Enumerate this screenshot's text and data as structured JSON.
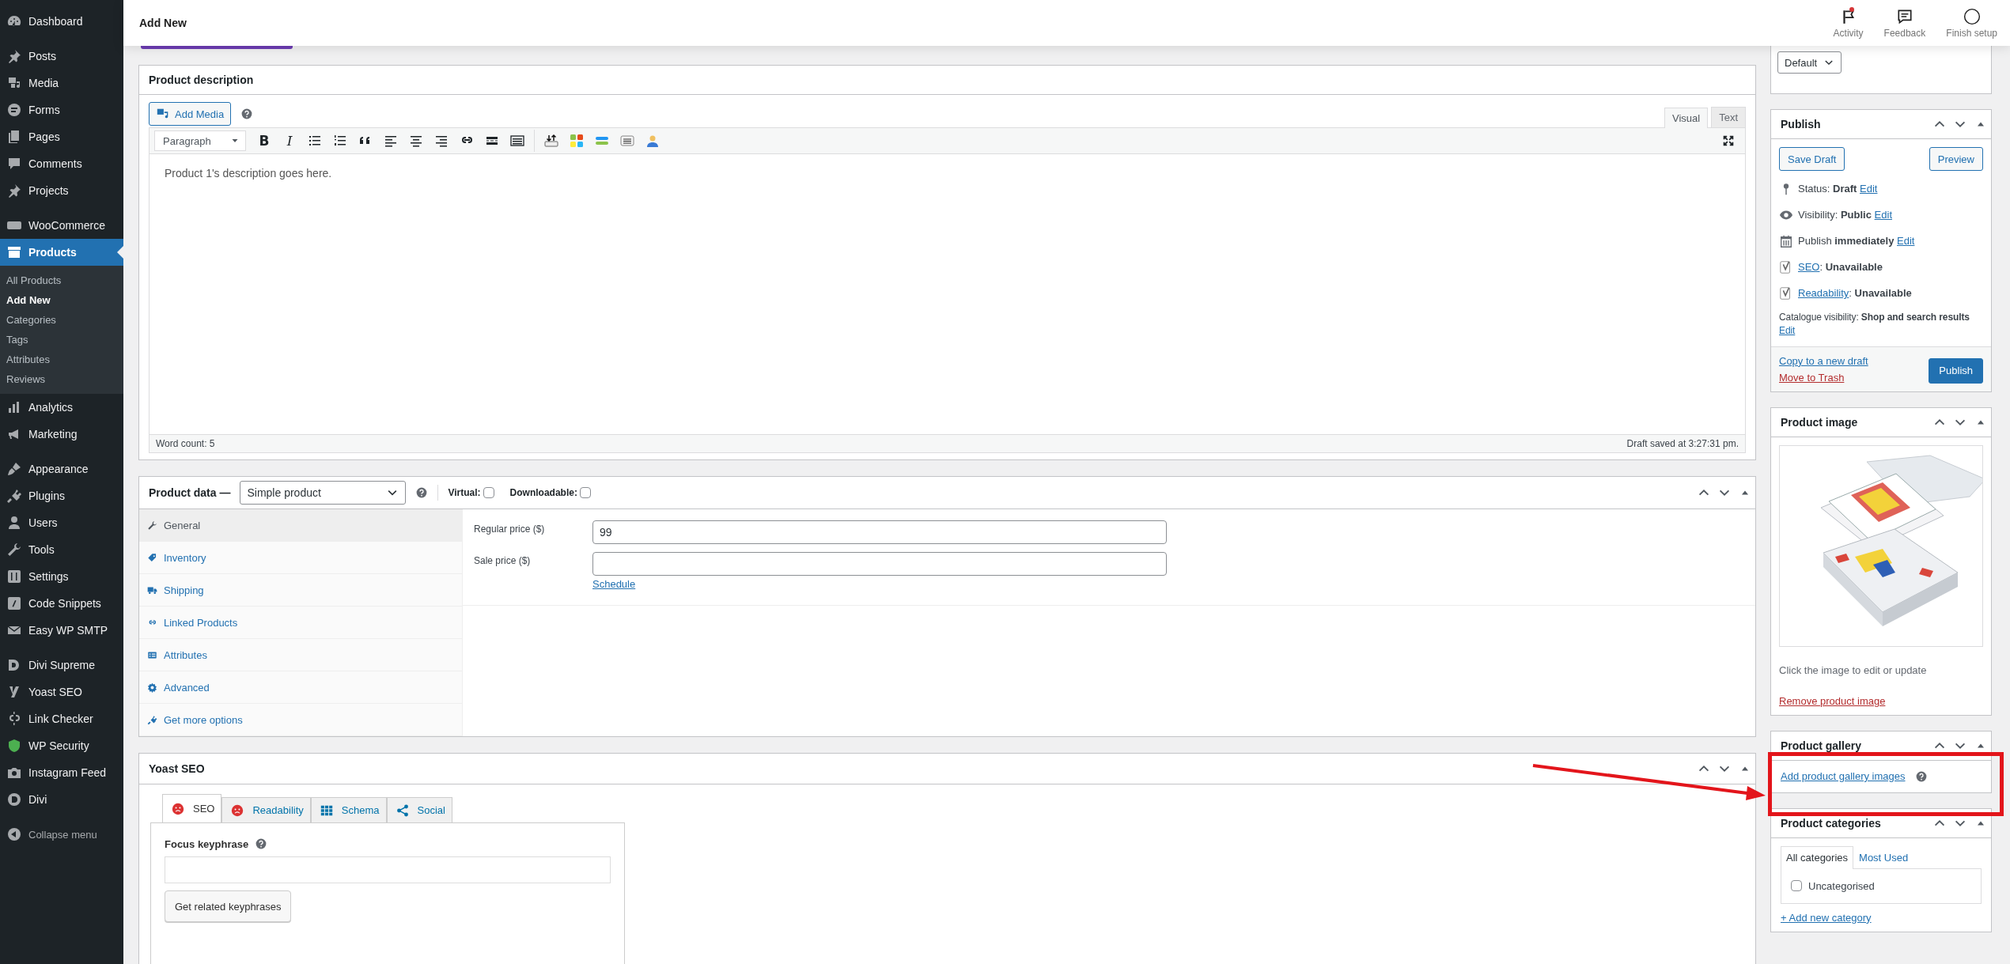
{
  "topbar": {
    "title": "Add New",
    "actions": [
      {
        "label": "Activity",
        "unread": true
      },
      {
        "label": "Feedback",
        "unread": false
      },
      {
        "label": "Finish setup",
        "unread": false
      }
    ]
  },
  "sidebar": {
    "groups": [
      {
        "items": [
          {
            "label": "Dashboard",
            "selected": false
          }
        ]
      },
      {
        "items": [
          {
            "label": "Posts",
            "selected": false
          },
          {
            "label": "Media",
            "selected": false
          },
          {
            "label": "Forms",
            "selected": false
          },
          {
            "label": "Pages",
            "selected": false
          },
          {
            "label": "Comments",
            "selected": false
          },
          {
            "label": "Projects",
            "selected": false
          }
        ]
      },
      {
        "items": [
          {
            "label": "WooCommerce",
            "selected": false
          },
          {
            "label": "Products",
            "selected": true,
            "children": [
              {
                "label": "All Products",
                "selected": false
              },
              {
                "label": "Add New",
                "selected": true
              },
              {
                "label": "Categories",
                "selected": false
              },
              {
                "label": "Tags",
                "selected": false
              },
              {
                "label": "Attributes",
                "selected": false
              },
              {
                "label": "Reviews",
                "selected": false
              }
            ]
          },
          {
            "label": "Analytics",
            "selected": false
          },
          {
            "label": "Marketing",
            "selected": false
          }
        ]
      },
      {
        "items": [
          {
            "label": "Appearance",
            "selected": false
          },
          {
            "label": "Plugins",
            "selected": false
          },
          {
            "label": "Users",
            "selected": false
          },
          {
            "label": "Tools",
            "selected": false
          },
          {
            "label": "Settings",
            "selected": false
          },
          {
            "label": "Code Snippets",
            "selected": false
          },
          {
            "label": "Easy WP SMTP",
            "selected": false
          }
        ]
      },
      {
        "items": [
          {
            "label": "Divi Supreme",
            "selected": false
          },
          {
            "label": "Yoast SEO",
            "selected": false
          },
          {
            "label": "Link Checker",
            "selected": false
          },
          {
            "label": "WP Security",
            "selected": false
          },
          {
            "label": "Instagram Feed",
            "selected": false
          },
          {
            "label": "Divi",
            "selected": false
          }
        ]
      }
    ],
    "collapse": "Collapse menu"
  },
  "product_description": {
    "title": "Product description",
    "add_media": "Add Media",
    "tabs": [
      {
        "label": "Visual",
        "selected": true
      },
      {
        "label": "Text",
        "selected": false
      }
    ],
    "format": "Paragraph",
    "format_buttons": [
      "B",
      "I"
    ],
    "content": "Product 1's description goes here.",
    "word_count": "Word count: 5",
    "saved": "Draft saved at 3:27:31 pm."
  },
  "product_data": {
    "title": "Product data —",
    "type": "Simple product",
    "options": [
      {
        "label": "Virtual:",
        "checked": false
      },
      {
        "label": "Downloadable:",
        "checked": false
      }
    ],
    "tabs": [
      {
        "label": "General",
        "selected": true
      },
      {
        "label": "Inventory",
        "selected": false
      },
      {
        "label": "Shipping",
        "selected": false
      },
      {
        "label": "Linked Products",
        "selected": false
      },
      {
        "label": "Attributes",
        "selected": false
      },
      {
        "label": "Advanced",
        "selected": false
      },
      {
        "label": "Get more options",
        "selected": false
      }
    ],
    "fields": [
      {
        "label": "Regular price ($)",
        "value": "99"
      },
      {
        "label": "Sale price ($)",
        "link": "Schedule"
      }
    ]
  },
  "yoast": {
    "title": "Yoast SEO",
    "tabs": [
      {
        "label": "SEO",
        "selected": true
      },
      {
        "label": "Readability",
        "selected": false
      },
      {
        "label": "Schema",
        "selected": false
      },
      {
        "label": "Social",
        "selected": false
      }
    ],
    "focus_label": "Focus keyphrase",
    "button": "Get related keyphrases"
  },
  "template": {
    "value": "Default"
  },
  "publish": {
    "title": "Publish",
    "save_draft": "Save Draft",
    "preview": "Preview",
    "rows": [
      {
        "kind": "status",
        "text": "Status: **Draft**",
        "link": "Edit"
      },
      {
        "kind": "visibility",
        "text": "Visibility: **Public**",
        "link": "Edit"
      },
      {
        "kind": "schedule",
        "text": "Publish **immediately**",
        "link": "Edit"
      },
      {
        "kind": "yoast",
        "link": "SEO",
        "text": ": **Unavailable**"
      },
      {
        "kind": "yoast",
        "link": "Readability",
        "text": ": **Unavailable**"
      },
      {
        "kind": "catalogue",
        "text": "Catalogue visibility: **Shop and search results**",
        "link": "Edit"
      }
    ],
    "copy_link": "Copy to a new draft",
    "trash_link": "Move to Trash",
    "publish_button": "Publish"
  },
  "product_image": {
    "title": "Product image",
    "hint": "Click the image to edit or update",
    "remove_link": "Remove product image"
  },
  "product_gallery": {
    "title": "Product gallery",
    "add_link": "Add product gallery images",
    "highlighted": true
  },
  "product_categories": {
    "title": "Product categories",
    "tabs": [
      {
        "label": "All categories",
        "selected": true
      },
      {
        "label": "Most Used",
        "selected": false
      }
    ],
    "categories": [
      {
        "label": "Uncategorised",
        "checked": false
      }
    ],
    "add_link": "+ Add new category"
  }
}
